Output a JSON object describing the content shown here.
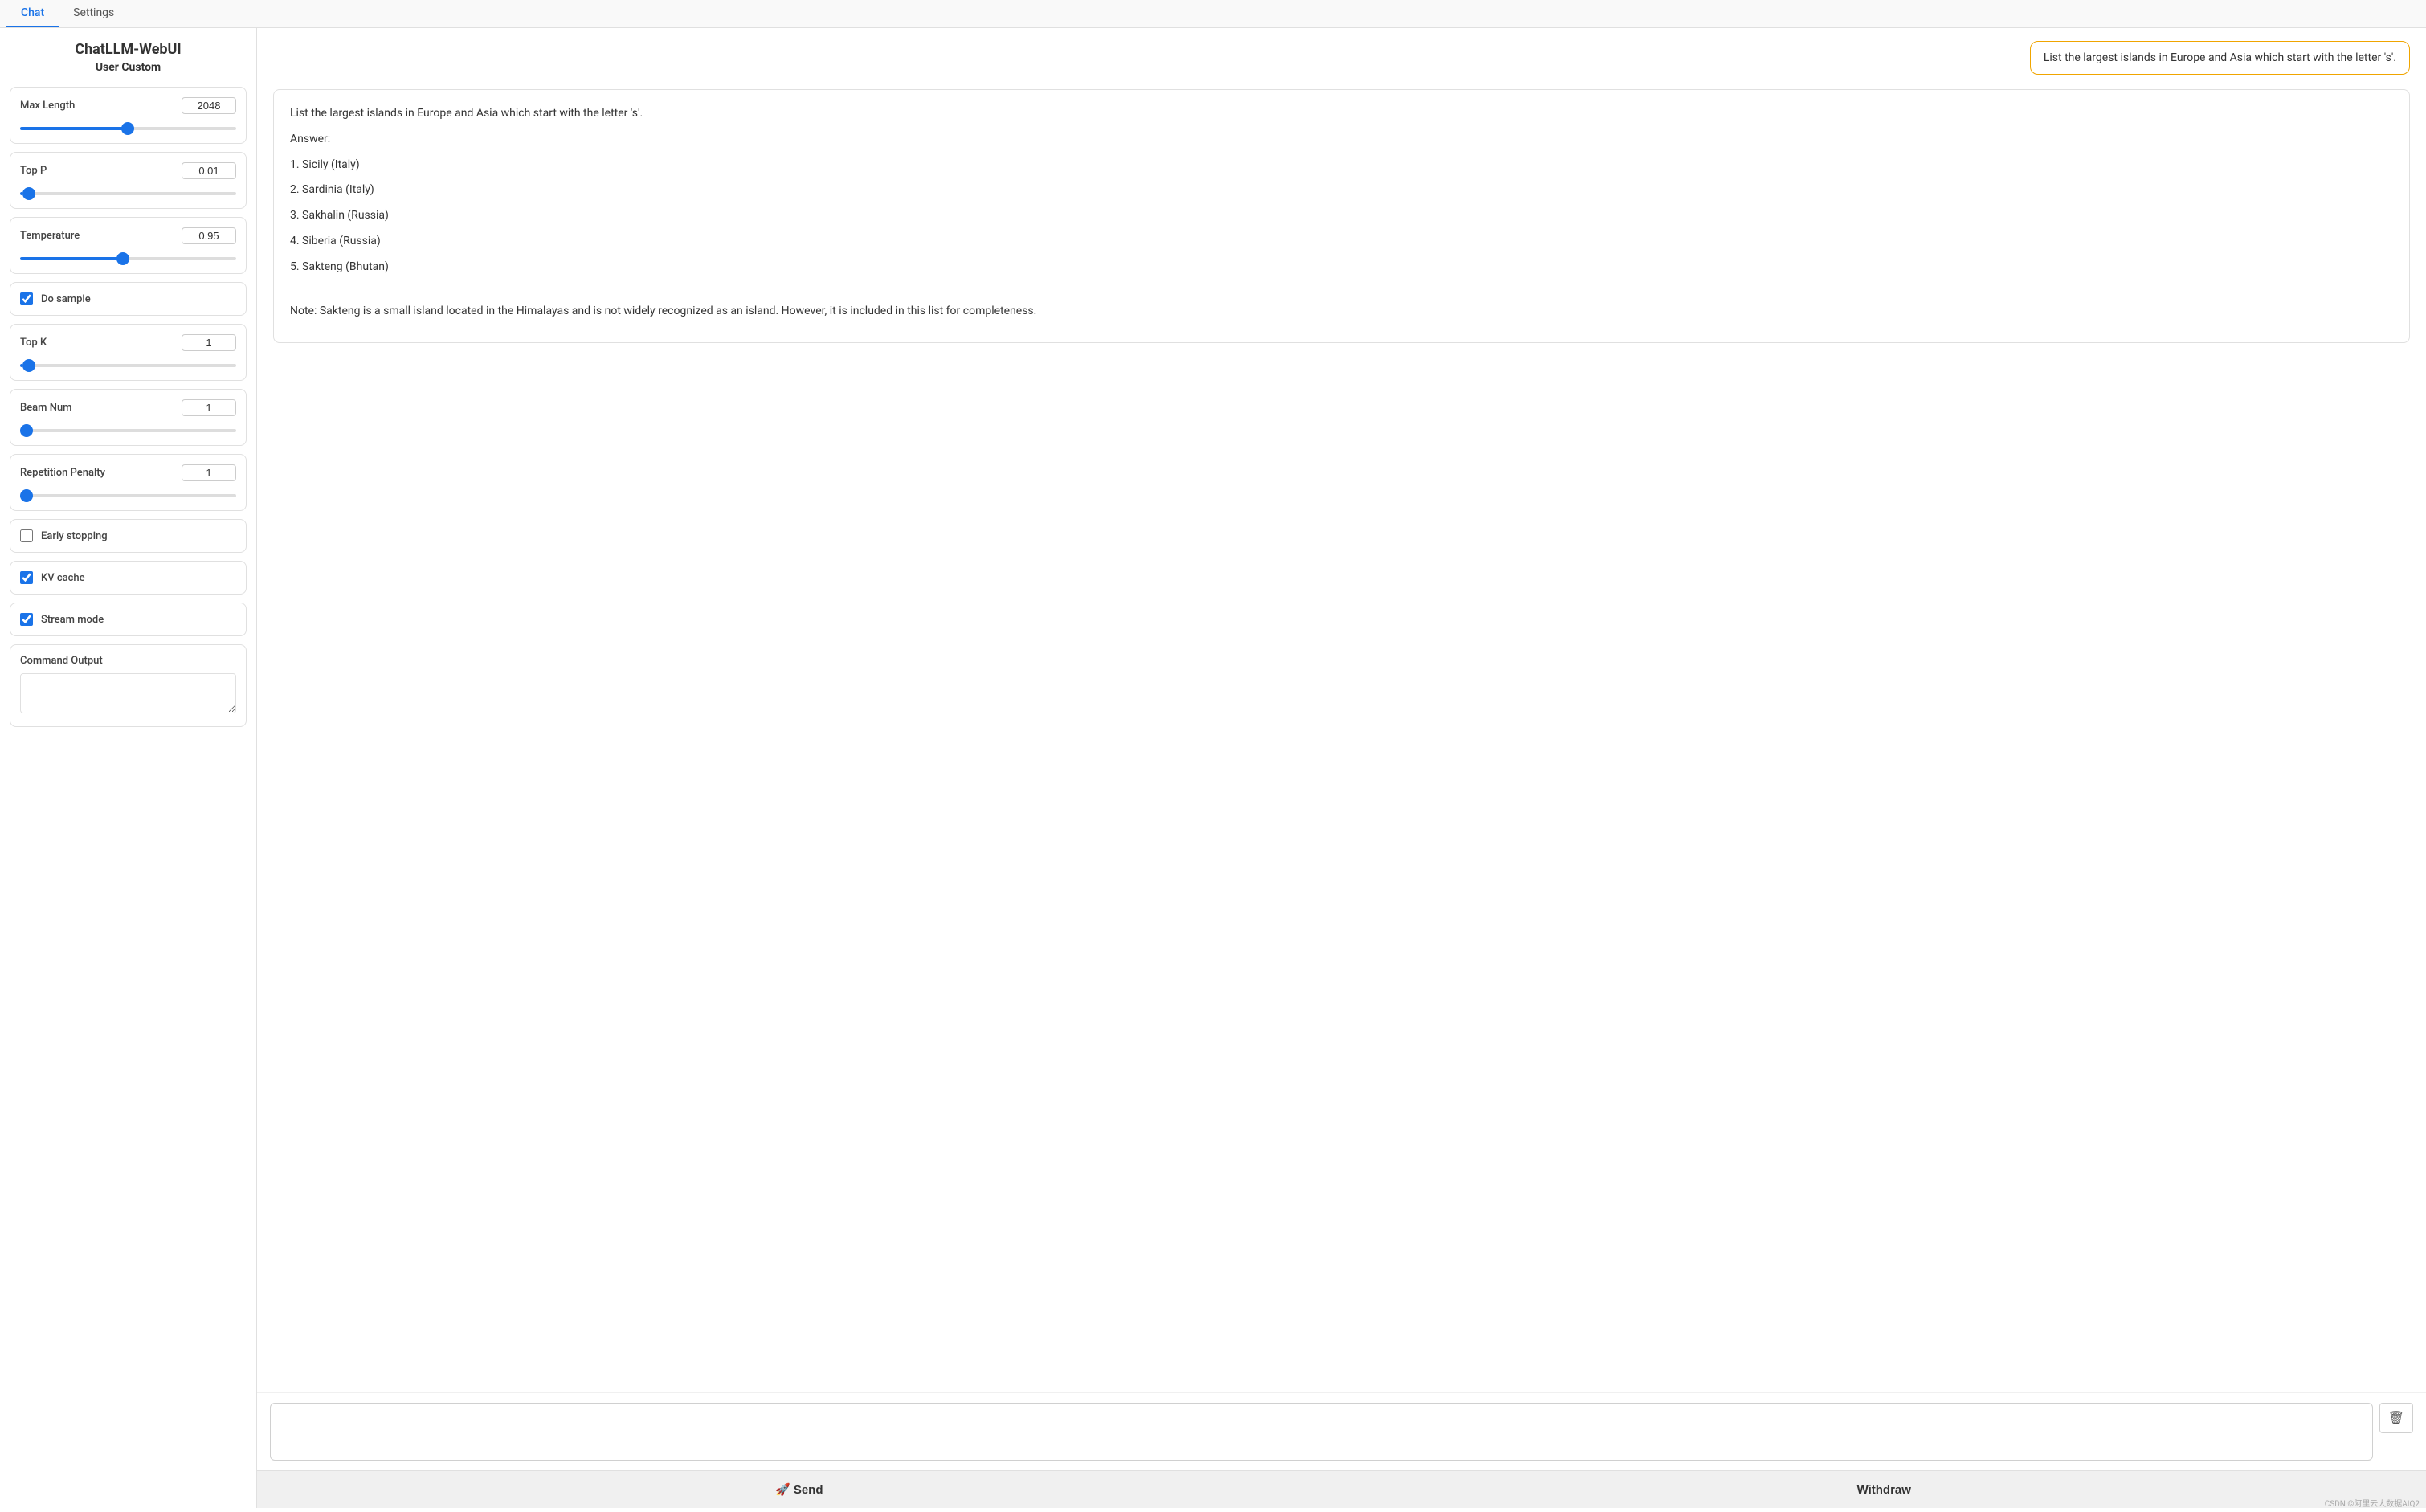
{
  "tabs": [
    {
      "label": "Chat",
      "active": true
    },
    {
      "label": "Settings",
      "active": false
    }
  ],
  "sidebar": {
    "app_title": "ChatLLM-WebUI",
    "subtitle": "User Custom",
    "controls": [
      {
        "id": "max-length",
        "label": "Max Length",
        "value": "2048",
        "min": 1,
        "max": 4096,
        "current": 2048,
        "pct": 50
      },
      {
        "id": "top-p",
        "label": "Top P",
        "value": "0.01",
        "min": 0,
        "max": 1,
        "current": 0.01,
        "pct": 1
      },
      {
        "id": "temperature",
        "label": "Temperature",
        "value": "0.95",
        "min": 0,
        "max": 2,
        "current": 0.95,
        "pct": 47
      }
    ],
    "checkboxes": [
      {
        "id": "do-sample",
        "label": "Do sample",
        "checked": true
      }
    ],
    "controls2": [
      {
        "id": "top-k",
        "label": "Top K",
        "value": "1",
        "min": 0,
        "max": 100,
        "current": 1,
        "pct": 1
      },
      {
        "id": "beam-num",
        "label": "Beam Num",
        "value": "1",
        "min": 1,
        "max": 10,
        "current": 1,
        "pct": 0
      },
      {
        "id": "repetition-penalty",
        "label": "Repetition Penalty",
        "value": "1",
        "min": 1,
        "max": 2,
        "current": 1,
        "pct": 0
      }
    ],
    "checkboxes2": [
      {
        "id": "early-stopping",
        "label": "Early stopping",
        "checked": false
      },
      {
        "id": "kv-cache",
        "label": "KV cache",
        "checked": true
      },
      {
        "id": "stream-mode",
        "label": "Stream mode",
        "checked": true
      }
    ],
    "command_output": {
      "label": "Command Output",
      "value": ""
    }
  },
  "chat": {
    "user_bubble": "List the largest islands in Europe and Asia which start with the letter 's'.",
    "assistant_prompt": "List the largest islands in Europe and Asia which start with the letter 's'.",
    "answer_label": "Answer:",
    "list_items": [
      "1. Sicily (Italy)",
      "2. Sardinia (Italy)",
      "3. Sakhalin (Russia)",
      "4. Siberia (Russia)",
      "5. Sakteng (Bhutan)"
    ],
    "note": "Note: Sakteng is a small island located in the Himalayas and is not widely recognized as an island. However, it is included in this list for completeness.",
    "input_placeholder": "",
    "send_label": "🚀 Send",
    "withdraw_label": "Withdraw"
  },
  "footer": "CSDN ©阿里云大数据AIQ2"
}
